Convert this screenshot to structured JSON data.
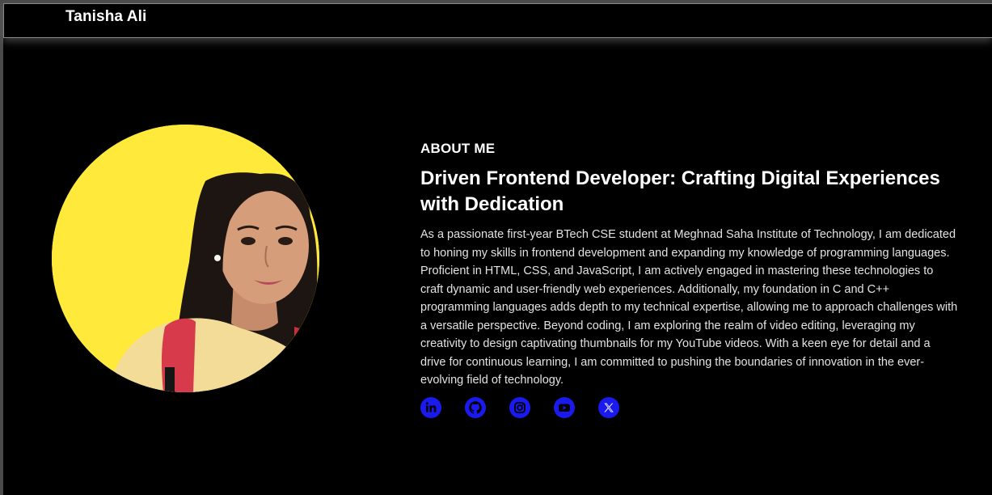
{
  "header": {
    "brand": "Tanisha Ali"
  },
  "about": {
    "eyebrow": "ABOUT ME",
    "headline": "Driven Frontend Developer: Crafting Digital Experiences with Dedication",
    "bio": "As a passionate first-year BTech CSE student at Meghnad Saha Institute of Technology, I am dedicated to honing my skills in frontend development and expanding my knowledge of programming languages. Proficient in HTML, CSS, and JavaScript, I am actively engaged in mastering these technologies to craft dynamic and user-friendly web experiences. Additionally, my foundation in C and C++ programming languages adds depth to my technical expertise, allowing me to approach challenges with a versatile perspective. Beyond coding, I am exploring the realm of video editing, leveraging my creativity to design captivating thumbnails for my YouTube videos. With a keen eye for detail and a drive for continuous learning, I am committed to pushing the boundaries of innovation in the ever-evolving field of technology."
  },
  "socials": [
    {
      "icon": "linkedin-icon"
    },
    {
      "icon": "github-icon"
    },
    {
      "icon": "instagram-icon"
    },
    {
      "icon": "youtube-icon"
    },
    {
      "icon": "x-twitter-icon"
    }
  ],
  "colors": {
    "background": "#000000",
    "avatar_background": "#ffe93a",
    "social_icon": "#1a1aee",
    "text": "#ffffff",
    "body_text": "#e2e2e2"
  }
}
